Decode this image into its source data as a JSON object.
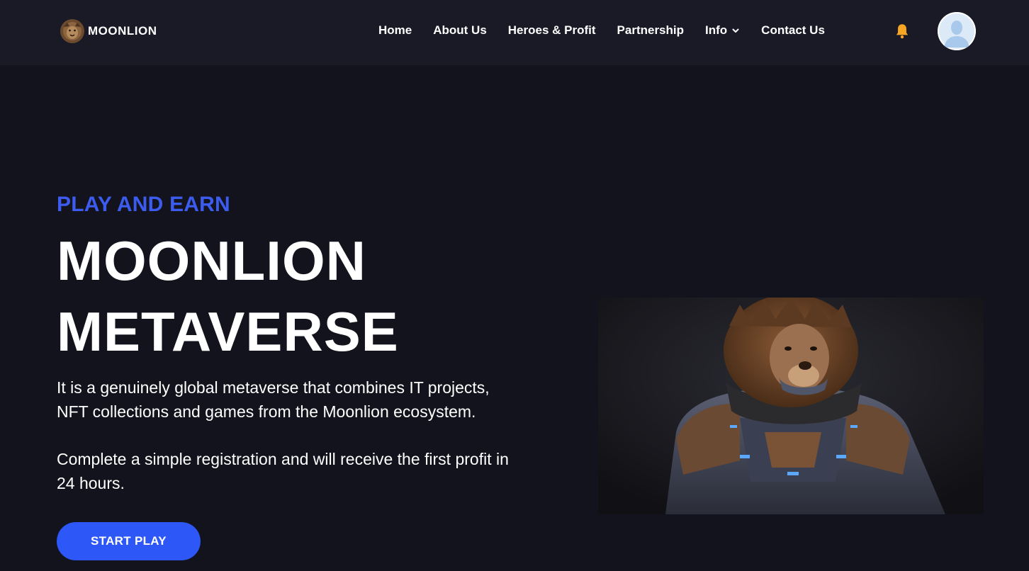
{
  "nav": {
    "brand": "MOONLION",
    "links": [
      {
        "label": "Home"
      },
      {
        "label": "About Us"
      },
      {
        "label": "Heroes & Profit"
      },
      {
        "label": "Partnership"
      },
      {
        "label": "Info"
      },
      {
        "label": "Contact Us"
      }
    ],
    "icons": {
      "notifications": "bell-icon",
      "info_dropdown": "chevron-down-icon",
      "profile": "user-avatar"
    }
  },
  "hero": {
    "eyebrow": "PLAY AND EARN",
    "title_line1": "MOONLION",
    "title_line2": "METAVERSE",
    "paragraph1": "It is a genuinely global metaverse that combines IT projects, NFT collections and games from the Moonlion ecosystem.",
    "paragraph2": "Complete a simple registration and will receive the first profit in 24 hours.",
    "cta_label": "START PLAY"
  },
  "colors": {
    "background": "#13131d",
    "navbar": "#191a26",
    "accent": "#2d57f6",
    "eyebrow": "#3c5cf0",
    "bell": "#f6a623"
  }
}
